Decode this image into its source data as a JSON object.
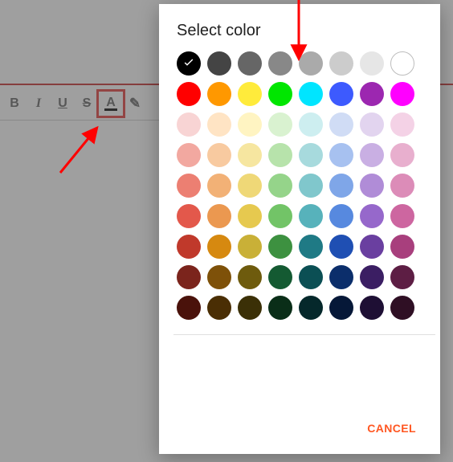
{
  "dialog": {
    "title": "Select color",
    "cancel_label": "CANCEL"
  },
  "toolbar": {
    "items": [
      {
        "name": "bold",
        "glyph": "B"
      },
      {
        "name": "italic",
        "glyph": "I"
      },
      {
        "name": "underline",
        "glyph": "U"
      },
      {
        "name": "strikethrough",
        "glyph": "S"
      },
      {
        "name": "text-color",
        "glyph": "A",
        "selected": true
      },
      {
        "name": "clear-format",
        "glyph": "✎"
      }
    ]
  },
  "colors": {
    "selected_index": 0,
    "rows": [
      [
        "#000000",
        "#444444",
        "#666666",
        "#888888",
        "#aaaaaa",
        "#cccccc",
        "#e6e6e6",
        "#ffffff"
      ],
      [
        "#ff0000",
        "#ff9800",
        "#ffeb3b",
        "#00e600",
        "#00e5ff",
        "#3d5afe",
        "#9c27b0",
        "#ff00ff"
      ],
      [
        "#f8d4d4",
        "#ffe4c4",
        "#fff4c2",
        "#d9f2d0",
        "#cdeef0",
        "#d0dcf5",
        "#e2d4ef",
        "#f4d2e6"
      ],
      [
        "#f2a8a0",
        "#f8caa0",
        "#f6e6a0",
        "#b7e3ab",
        "#a7dadd",
        "#a7c1f0",
        "#c9afe3",
        "#e8afce"
      ],
      [
        "#ec7f72",
        "#f2b176",
        "#efd877",
        "#95d48a",
        "#80c7cc",
        "#7fa6e8",
        "#b08cd7",
        "#dc8cb8"
      ],
      [
        "#e3584b",
        "#eb9850",
        "#e6c94f",
        "#72c467",
        "#57b2bb",
        "#5789df",
        "#9668cb",
        "#cd66a0"
      ],
      [
        "#c0392b",
        "#d68910",
        "#c9b037",
        "#3d9140",
        "#1f7a85",
        "#1f4fb3",
        "#6a3fa0",
        "#a83f7d"
      ],
      [
        "#7b241c",
        "#7e5109",
        "#6e5b0d",
        "#145a32",
        "#0b4f54",
        "#0b2e6b",
        "#3b1e63",
        "#5d1e44"
      ],
      [
        "#4a120b",
        "#4a2e04",
        "#3b3007",
        "#0a2e18",
        "#05282b",
        "#061838",
        "#1e0f34",
        "#2f0f24"
      ]
    ]
  },
  "annotations": {
    "arrow_to_swatches": true,
    "arrow_to_toolbar": true,
    "highlight_text_color_button": true
  }
}
